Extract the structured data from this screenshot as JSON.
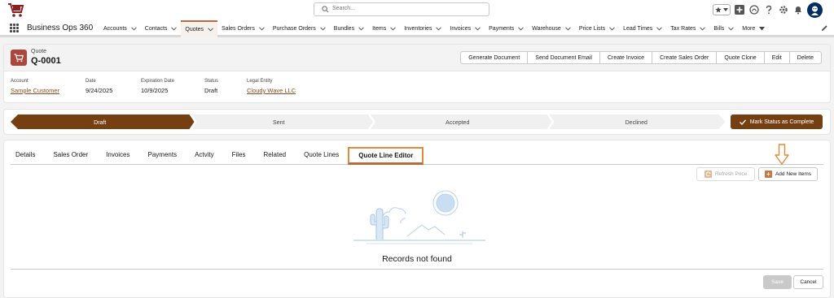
{
  "header": {
    "search_placeholder": "Search..."
  },
  "nav": {
    "app_name": "Business Ops 360",
    "items": [
      {
        "label": "Accounts"
      },
      {
        "label": "Contacts"
      },
      {
        "label": "Quotes"
      },
      {
        "label": "Sales Orders"
      },
      {
        "label": "Purchase Orders"
      },
      {
        "label": "Bundles"
      },
      {
        "label": "Items"
      },
      {
        "label": "Inventories"
      },
      {
        "label": "Invoices"
      },
      {
        "label": "Payments"
      },
      {
        "label": "Warehouse"
      },
      {
        "label": "Price Lists"
      },
      {
        "label": "Lead Times"
      },
      {
        "label": "Tax Rates"
      },
      {
        "label": "Bills"
      }
    ],
    "active_item": "Quotes",
    "more_label": "More"
  },
  "record": {
    "object_label": "Quote",
    "name": "Q-0001",
    "actions": [
      "Generate Document",
      "Send Document Email",
      "Create Invoice",
      "Create Sales Order",
      "Quote Clone",
      "Edit",
      "Delete"
    ],
    "fields": {
      "account": {
        "label": "Account",
        "value": "Sample Customer"
      },
      "date": {
        "label": "Date",
        "value": "9/24/2025"
      },
      "expiration": {
        "label": "Expiration Date",
        "value": "10/9/2025"
      },
      "status": {
        "label": "Status",
        "value": "Draft"
      },
      "legal_entity": {
        "label": "Legal Entity",
        "value": "Cloudy Wave LLC"
      }
    }
  },
  "path": {
    "stages": [
      "Draft",
      "Sent",
      "Accepted",
      "Declined"
    ],
    "current_stage": "Draft",
    "complete_button": "Mark Status as Complete"
  },
  "tabs": {
    "items": [
      "Details",
      "Sales Order",
      "Invoices",
      "Payments",
      "Actvity",
      "Files",
      "Related",
      "Quote Lines",
      "Quote Line Editor"
    ],
    "active": "Quote Line Editor"
  },
  "editor": {
    "refresh_label": "Refresh Price",
    "add_label": "Add New Items",
    "empty_text": "Records not found",
    "save_label": "Save",
    "cancel_label": "Cancel"
  },
  "colors": {
    "brand": "#763f12",
    "accent": "#b76c3f",
    "highlight": "#e38a3a",
    "object_icon": "#ad473d"
  },
  "icons": {
    "logo": "cart-logo-icon",
    "search": "search-icon",
    "favorites": "star-icon",
    "add": "plus-icon",
    "trailhead": "cloud-icon",
    "help": "question-icon",
    "setup": "gear-icon",
    "notifications": "bell-icon",
    "avatar": "avatar-icon"
  }
}
